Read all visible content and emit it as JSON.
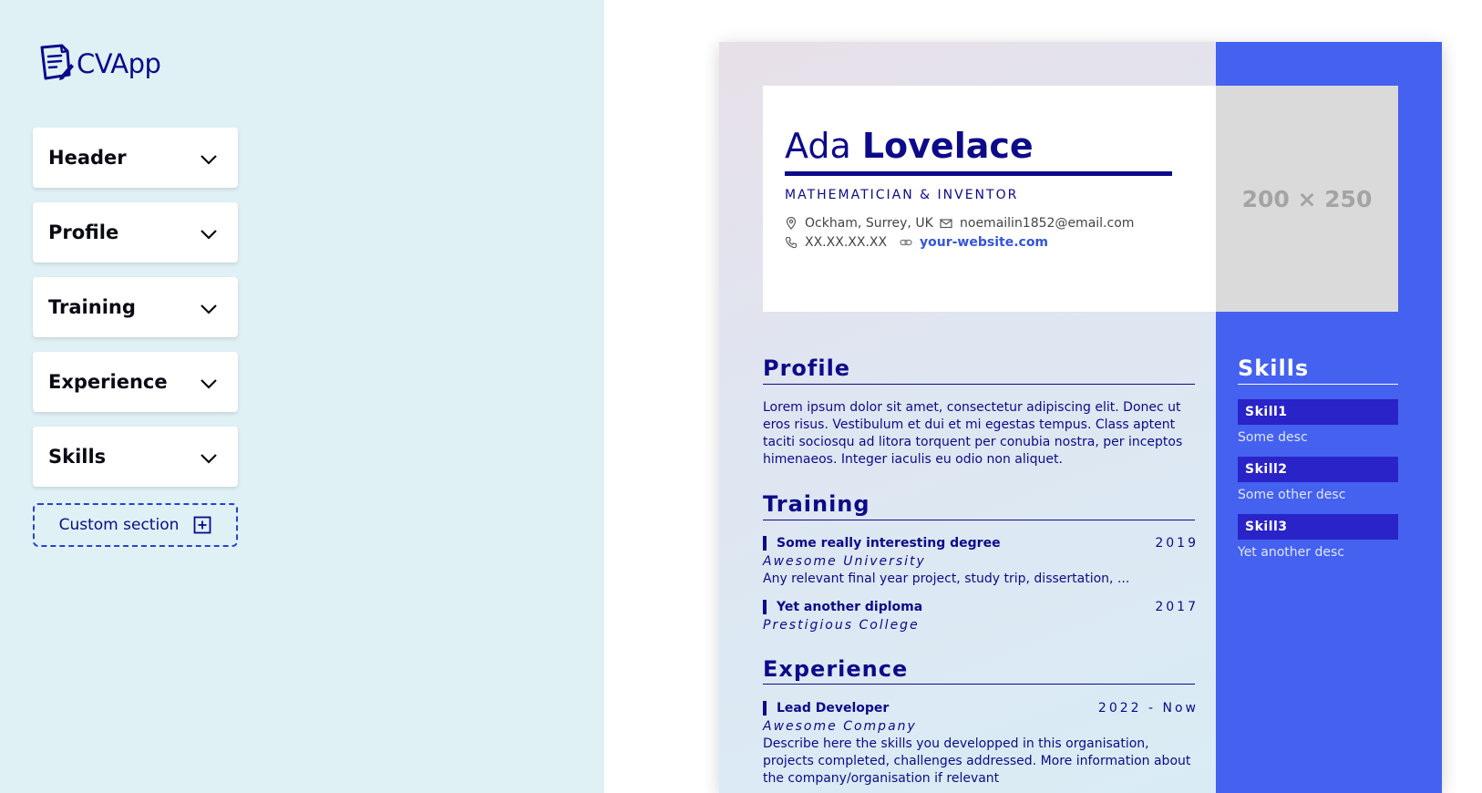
{
  "app": {
    "name": "CVApp"
  },
  "editor": {
    "sections": [
      {
        "label": "Header"
      },
      {
        "label": "Profile"
      },
      {
        "label": "Training"
      },
      {
        "label": "Experience"
      },
      {
        "label": "Skills"
      }
    ],
    "custom_section_label": "Custom section"
  },
  "cv": {
    "name_first": "Ada",
    "name_last": "Lovelace",
    "job_title": "MATHEMATICIAN & INVENTOR",
    "contact": {
      "location": "Ockham, Surrey, UK",
      "email": "noemailin1852@email.com",
      "phone": "XX.XX.XX.XX",
      "website": "your-website.com"
    },
    "photo_placeholder": "200 × 250",
    "profile": {
      "title": "Profile",
      "text": "Lorem ipsum dolor sit amet, consectetur adipiscing elit. Donec ut eros risus. Vestibulum et dui et mi egestas tempus. Class aptent taciti sociosqu ad litora torquent per conubia nostra, per inceptos himenaeos. Integer iaculis eu odio non aliquet."
    },
    "training": {
      "title": "Training",
      "items": [
        {
          "title": "Some really interesting degree",
          "date": "2019",
          "org": "Awesome University",
          "desc": "Any relevant final year project, study trip, dissertation, ..."
        },
        {
          "title": "Yet another diploma",
          "date": "2017",
          "org": "Prestigious College",
          "desc": ""
        }
      ]
    },
    "experience": {
      "title": "Experience",
      "items": [
        {
          "title": "Lead Developer",
          "date": "2022 - Now",
          "org": "Awesome Company",
          "desc": "Describe here the skills you developped in this organisation, projects completed, challenges addressed. More information about the company/organisation if relevant"
        }
      ]
    },
    "skills": {
      "title": "Skills",
      "items": [
        {
          "name": "Skill1",
          "desc": "Some desc"
        },
        {
          "name": "Skill2",
          "desc": "Some other desc"
        },
        {
          "name": "Skill3",
          "desc": "Yet another desc"
        }
      ]
    }
  },
  "colors": {
    "editor_bg": "#e0f1f6",
    "navy": "#0d0a8a",
    "sidebar_blue": "#4461f0",
    "skill_bar": "#2a23c8",
    "link": "#3355dd"
  }
}
